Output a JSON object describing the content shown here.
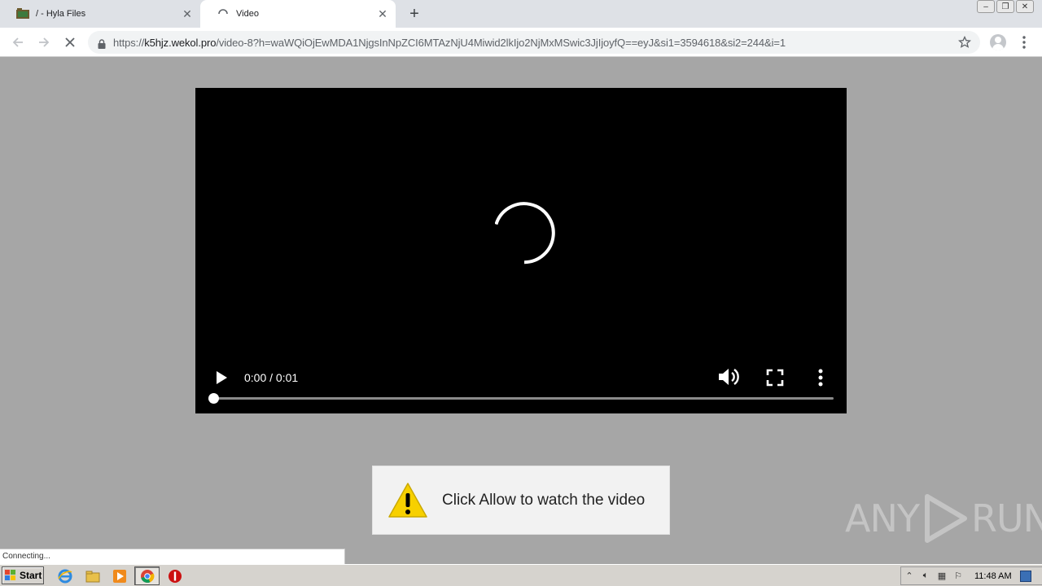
{
  "browser": {
    "tabs": [
      {
        "title": "/ - Hyla Files",
        "active": false,
        "close": "✕"
      },
      {
        "title": "Video",
        "active": true,
        "close": "✕"
      }
    ],
    "new_tab": "+",
    "window_controls": {
      "minimize": "–",
      "maximize": "❐",
      "close": "✕"
    },
    "url_scheme": "https://",
    "url_host": "k5hjz.wekol.pro",
    "url_path": "/video-8?h=waWQiOjEwMDA1NjgsInNpZCI6MTAzNjU4Miwid2lkIjo2NjMxMSwic3JjIjoyfQ==eyJ&si1=3594618&si2=244&i=1",
    "status_text": "Connecting..."
  },
  "icons": {
    "back": "arrow-left-icon",
    "forward": "arrow-right-icon",
    "stop": "stop-x-icon",
    "lock": "lock-icon",
    "bookmark": "star-icon",
    "profile": "avatar-icon",
    "menu": "kebab-menu-icon"
  },
  "player": {
    "time": "0:00 / 0:01",
    "progress": 0.0,
    "state": "loading"
  },
  "notice": {
    "message": "Click Allow to watch the video"
  },
  "watermark": {
    "left": "ANY",
    "right": "RUN"
  },
  "taskbar": {
    "start_label": "Start",
    "clock": "11:48 AM"
  },
  "colors": {
    "page_bg": "#a6a6a6",
    "video_bg": "#000000",
    "warning_yellow": "#f7d000",
    "tab_strip": "#dee1e6"
  }
}
